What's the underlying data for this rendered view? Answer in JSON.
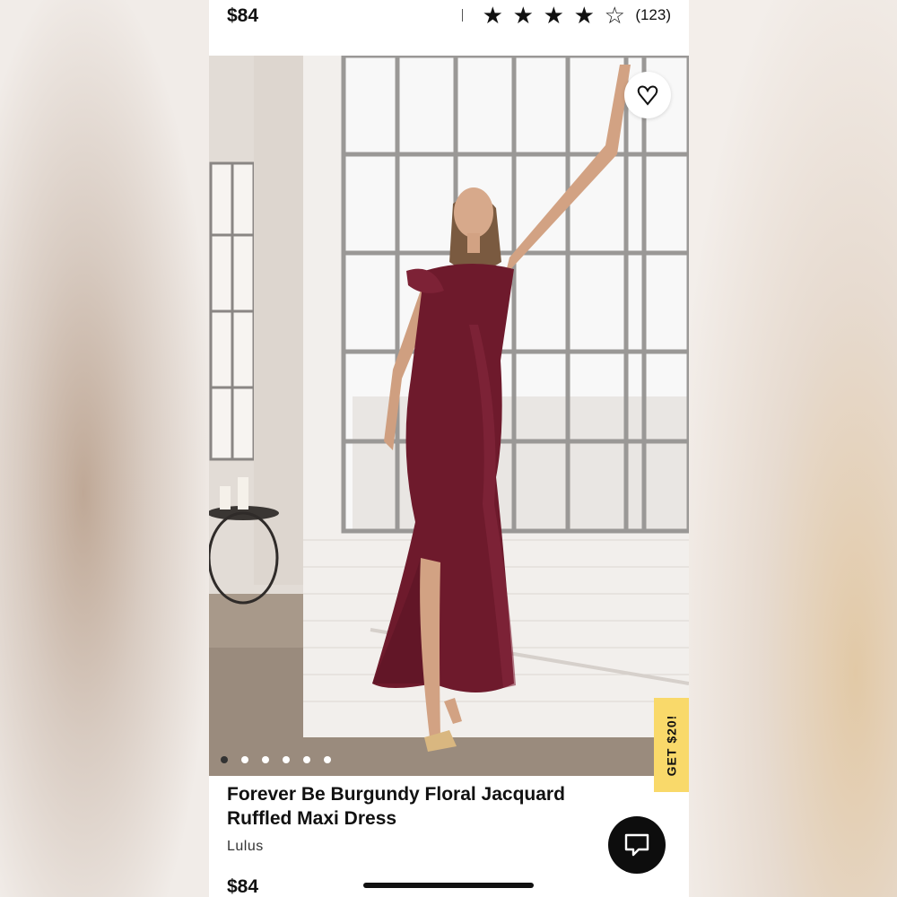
{
  "product": {
    "price_top": "$84",
    "rating": {
      "stars": 4,
      "max_stars": 5,
      "count": "(123)"
    },
    "title": "Forever Be Burgundy Floral Jacquard Ruffled Maxi Dress",
    "brand": "Lulus",
    "price_bottom": "$84"
  },
  "gallery": {
    "image_count": 6,
    "active_index": 0
  },
  "promo": {
    "label": "GET $20!",
    "color": "#f9d96a"
  },
  "icons": {
    "favorite": "heart-outline-icon",
    "chat": "chat-bubble-icon",
    "star_filled": "star-filled-icon",
    "star_empty": "star-outline-icon"
  },
  "colors": {
    "dress": "#6e1a2c",
    "text": "#111111"
  }
}
